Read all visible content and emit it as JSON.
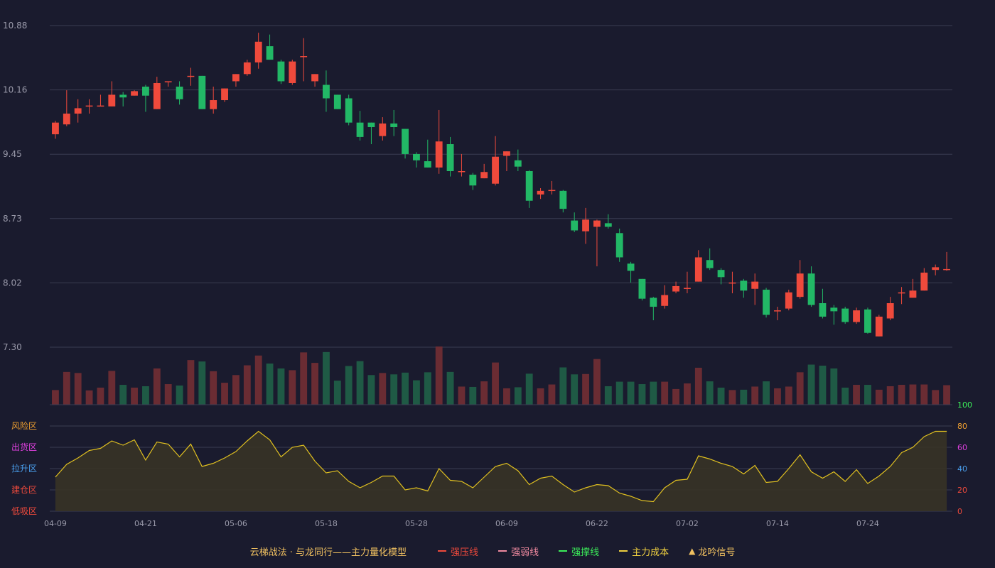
{
  "legend": {
    "title": "云梯战法 · 与龙同行——主力量化模型",
    "items": [
      {
        "label": "强压线",
        "color": "#ef4a3c",
        "style": "solid"
      },
      {
        "label": "强弱线",
        "color": "#f08aa0",
        "style": "dashed"
      },
      {
        "label": "强撑线",
        "color": "#3cf05a",
        "style": "solid"
      },
      {
        "label": "主力成本",
        "color": "#f0d040",
        "style": "dashed"
      },
      {
        "label": "龙吟信号",
        "color": "#f0c060",
        "style": "triangle"
      }
    ]
  },
  "colors": {
    "up": "#ef4a3c",
    "down": "#22b866",
    "vol_up": "#6a2c33",
    "vol_down": "#1f5a45",
    "grid": "#3a3c52",
    "osc_line": "#e0c020",
    "osc_fill": "#3a3424",
    "axis_text": "#9a9aaa"
  },
  "chart_data": [
    {
      "type": "candlestick",
      "y_ticks": [
        "10.88",
        "10.16",
        "9.45",
        "8.73",
        "8.02",
        "7.30"
      ],
      "ylim": [
        7.3,
        10.88
      ],
      "x_labels": [
        "04-09",
        "04-21",
        "05-06",
        "05-18",
        "05-28",
        "06-09",
        "06-22",
        "07-02",
        "07-14",
        "07-24"
      ],
      "x_label_index": [
        0,
        8,
        16,
        24,
        32,
        40,
        48,
        56,
        64,
        72
      ],
      "candles": [
        [
          9.67,
          9.8,
          9.62,
          9.82
        ],
        [
          9.78,
          9.9,
          9.76,
          10.16
        ],
        [
          9.9,
          9.96,
          9.8,
          10.06
        ],
        [
          9.98,
          9.99,
          9.9,
          10.06
        ],
        [
          9.98,
          9.99,
          9.98,
          10.11
        ],
        [
          9.98,
          10.11,
          9.98,
          10.26
        ],
        [
          10.11,
          10.08,
          9.98,
          10.14
        ],
        [
          10.1,
          10.15,
          10.1,
          10.16
        ],
        [
          10.2,
          10.1,
          9.92,
          10.22
        ],
        [
          9.95,
          10.24,
          9.95,
          10.31
        ],
        [
          10.25,
          10.26,
          10.2,
          10.26
        ],
        [
          10.2,
          10.06,
          10.0,
          10.26
        ],
        [
          10.31,
          10.32,
          10.21,
          10.41
        ],
        [
          10.32,
          9.95,
          9.95,
          10.32
        ],
        [
          9.95,
          10.05,
          9.9,
          10.2
        ],
        [
          10.05,
          10.18,
          10.03,
          10.18
        ],
        [
          10.26,
          10.34,
          10.2,
          10.34
        ],
        [
          10.34,
          10.47,
          10.32,
          10.5
        ],
        [
          10.47,
          10.7,
          10.4,
          10.8
        ],
        [
          10.65,
          10.5,
          10.5,
          10.78
        ],
        [
          10.48,
          10.26,
          10.23,
          10.5
        ],
        [
          10.24,
          10.48,
          10.22,
          10.5
        ],
        [
          10.54,
          10.54,
          10.26,
          10.74
        ],
        [
          10.26,
          10.34,
          10.2,
          10.34
        ],
        [
          10.22,
          10.07,
          9.92,
          10.38
        ],
        [
          10.11,
          9.95,
          9.95,
          10.11
        ],
        [
          10.07,
          9.8,
          9.77,
          10.11
        ],
        [
          9.8,
          9.64,
          9.6,
          9.93
        ],
        [
          9.8,
          9.75,
          9.56,
          9.8
        ],
        [
          9.65,
          9.79,
          9.6,
          9.86
        ],
        [
          9.79,
          9.75,
          9.65,
          9.94
        ],
        [
          9.73,
          9.45,
          9.4,
          9.73
        ],
        [
          9.45,
          9.38,
          9.3,
          9.47
        ],
        [
          9.37,
          9.3,
          9.3,
          9.61
        ],
        [
          9.3,
          9.59,
          9.23,
          9.94
        ],
        [
          9.56,
          9.26,
          9.2,
          9.64
        ],
        [
          9.26,
          9.26,
          9.2,
          9.45
        ],
        [
          9.22,
          9.1,
          9.05,
          9.24
        ],
        [
          9.18,
          9.25,
          9.18,
          9.34
        ],
        [
          9.12,
          9.42,
          9.1,
          9.65
        ],
        [
          9.43,
          9.48,
          9.26,
          9.48
        ],
        [
          9.38,
          9.31,
          9.26,
          9.5
        ],
        [
          9.26,
          8.93,
          8.85,
          9.27
        ],
        [
          9.0,
          9.04,
          8.95,
          9.07
        ],
        [
          9.05,
          9.05,
          9.0,
          9.15
        ],
        [
          9.04,
          8.84,
          8.8,
          9.05
        ],
        [
          8.71,
          8.6,
          8.58,
          8.8
        ],
        [
          8.59,
          8.72,
          8.45,
          8.85
        ],
        [
          8.64,
          8.71,
          8.2,
          8.72
        ],
        [
          8.68,
          8.64,
          8.62,
          8.78
        ],
        [
          8.57,
          8.3,
          8.25,
          8.62
        ],
        [
          8.23,
          8.15,
          8.02,
          8.25
        ],
        [
          8.06,
          7.84,
          7.82,
          8.06
        ],
        [
          7.85,
          7.75,
          7.6,
          7.86
        ],
        [
          7.76,
          7.88,
          7.73,
          7.99
        ],
        [
          7.92,
          7.98,
          7.9,
          8.03
        ],
        [
          7.96,
          7.96,
          7.9,
          8.14
        ],
        [
          8.03,
          8.3,
          8.03,
          8.38
        ],
        [
          8.27,
          8.18,
          8.16,
          8.4
        ],
        [
          8.16,
          8.08,
          8.0,
          8.18
        ],
        [
          8.02,
          8.02,
          7.9,
          8.14
        ],
        [
          8.04,
          7.93,
          7.85,
          8.06
        ],
        [
          7.95,
          8.03,
          7.77,
          8.12
        ],
        [
          7.94,
          7.66,
          7.63,
          7.96
        ],
        [
          7.71,
          7.71,
          7.6,
          7.75
        ],
        [
          7.73,
          7.91,
          7.71,
          7.94
        ],
        [
          7.86,
          8.12,
          7.84,
          8.27
        ],
        [
          8.12,
          7.77,
          7.75,
          8.2
        ],
        [
          7.79,
          7.64,
          7.62,
          7.95
        ],
        [
          7.74,
          7.7,
          7.55,
          7.77
        ],
        [
          7.73,
          7.58,
          7.56,
          7.75
        ],
        [
          7.58,
          7.71,
          7.56,
          7.74
        ],
        [
          7.72,
          7.46,
          7.45,
          7.74
        ],
        [
          7.42,
          7.64,
          7.42,
          7.66
        ],
        [
          7.62,
          7.79,
          7.6,
          7.86
        ],
        [
          7.9,
          7.91,
          7.78,
          7.97
        ],
        [
          7.85,
          7.93,
          7.85,
          8.06
        ],
        [
          7.93,
          8.13,
          7.93,
          8.18
        ],
        [
          8.16,
          8.19,
          8.1,
          8.22
        ],
        [
          8.16,
          8.17,
          8.15,
          8.36
        ]
      ]
    },
    {
      "type": "bar",
      "name": "volume",
      "values": [
        42,
        94,
        91,
        41,
        49,
        97,
        57,
        49,
        53,
        104,
        59,
        55,
        128,
        124,
        96,
        63,
        85,
        113,
        141,
        118,
        104,
        99,
        150,
        120,
        151,
        69,
        111,
        125,
        85,
        91,
        87,
        92,
        70,
        93,
        167,
        94,
        52,
        51,
        67,
        121,
        47,
        50,
        89,
        47,
        58,
        107,
        87,
        88,
        131,
        53,
        66,
        66,
        59,
        66,
        66,
        45,
        61,
        106,
        67,
        49,
        42,
        43,
        52,
        67,
        47,
        52,
        93,
        115,
        112,
        104,
        49,
        57,
        57,
        43,
        53,
        57,
        58,
        58,
        42,
        56
      ]
    },
    {
      "type": "area",
      "name": "oscillator",
      "y_ticks": [
        0,
        20,
        40,
        60,
        80
      ],
      "y_tick_colors": [
        "#ef4a3c",
        "#ef4a3c",
        "#4aa0ef",
        "#e040e0",
        "#f0a030"
      ],
      "top_tick": "100",
      "top_tick_color": "#3cf05a",
      "zones": [
        {
          "label": "风险区",
          "color": "#f0a030"
        },
        {
          "label": "出货区",
          "color": "#e040e0"
        },
        {
          "label": "拉升区",
          "color": "#4aa0ef"
        },
        {
          "label": "建仓区",
          "color": "#ef4a3c"
        },
        {
          "label": "低吸区",
          "color": "#ef4a3c"
        }
      ],
      "ylim": [
        0,
        100
      ],
      "values": [
        32,
        44,
        50,
        57,
        59,
        66,
        62,
        67,
        48,
        65,
        63,
        51,
        63,
        42,
        45,
        50,
        56,
        66,
        75,
        67,
        51,
        60,
        62,
        47,
        36,
        38,
        28,
        22,
        27,
        33,
        33,
        20,
        22,
        19,
        40,
        29,
        28,
        22,
        32,
        42,
        45,
        38,
        25,
        31,
        33,
        25,
        18,
        22,
        25,
        24,
        17,
        14,
        10,
        9,
        22,
        29,
        30,
        52,
        49,
        45,
        42,
        35,
        43,
        27,
        28,
        40,
        53,
        37,
        31,
        37,
        28,
        39,
        26,
        33,
        42,
        55,
        60,
        70,
        75,
        75
      ]
    }
  ]
}
